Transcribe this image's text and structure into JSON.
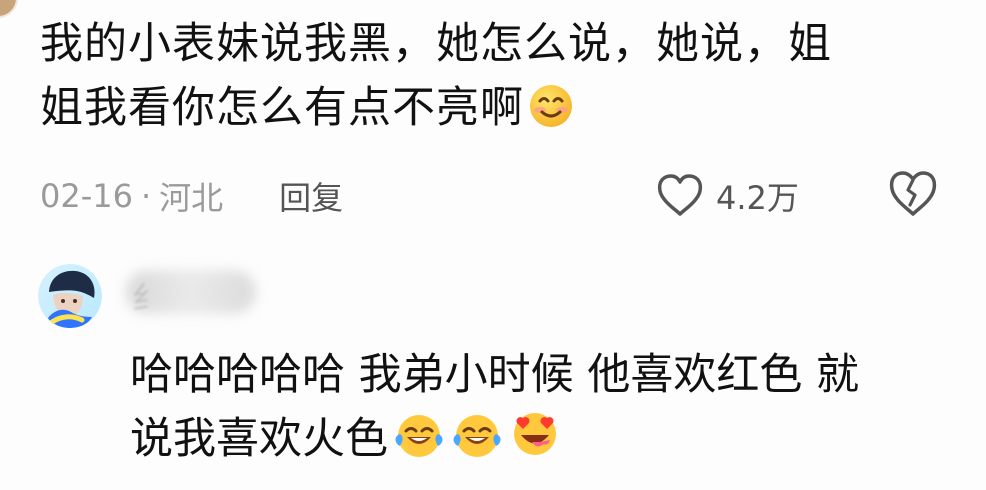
{
  "comment": {
    "lines": [
      "我的小表妹说我黑，她怎么说，她说，姐",
      "姐我看你怎么有点不亮啊"
    ],
    "emoji": "smiling-face-icon",
    "date": "02-16",
    "separator": "·",
    "location": "河北",
    "reply_label": "回复",
    "like_count": "4.2万"
  },
  "reply": {
    "username_visible": "纟",
    "lines": [
      "哈哈哈哈哈 我弟小时候 他喜欢红色 就",
      "说我喜欢火色"
    ],
    "emojis": [
      "crying-laughing-face-icon",
      "crying-laughing-face-icon",
      "star-struck-face-icon"
    ]
  },
  "colors": {
    "text": "#111111",
    "meta": "#9a9a9a",
    "icon": "#555555",
    "emoji_yellow": "#ffc83d",
    "tear_blue": "#4aa7ff",
    "heart_red": "#ff3b30"
  }
}
